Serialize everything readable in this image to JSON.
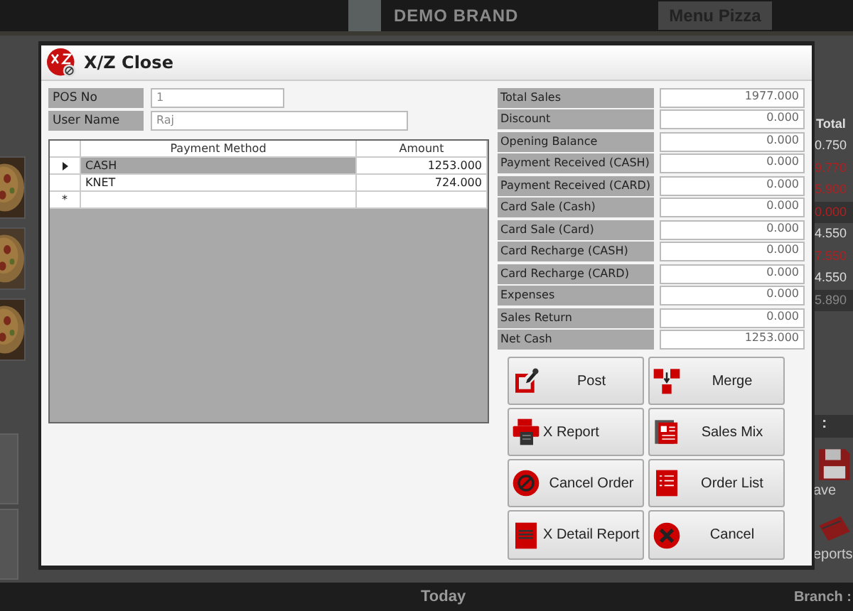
{
  "background": {
    "brand": "DEMO BRAND",
    "menu_button": "Menu Pizza",
    "totals_header": "Total",
    "totals": [
      {
        "value": "0.750",
        "color": "#dddddd",
        "shaded": false
      },
      {
        "value": "9.770",
        "color": "#b02020",
        "shaded": false
      },
      {
        "value": "5.900",
        "color": "#b02020",
        "shaded": false
      },
      {
        "value": "0.000",
        "color": "#b02020",
        "shaded": true
      },
      {
        "value": "4.550",
        "color": "#dddddd",
        "shaded": false
      },
      {
        "value": "7.550",
        "color": "#b02020",
        "shaded": false
      },
      {
        "value": "4.550",
        "color": "#dddddd",
        "shaded": false
      },
      {
        "value": "5.890",
        "color": "#888888",
        "shaded": true
      }
    ],
    "separator": ":",
    "side_buttons": [
      {
        "label": "ave",
        "kind": "save"
      },
      {
        "label": "eports",
        "kind": "reports"
      }
    ],
    "footer": {
      "date_label": "Today",
      "branch_label": "Branch :"
    }
  },
  "dialog": {
    "title": "X/Z Close",
    "fields": [
      {
        "label": "POS No",
        "value": "1"
      },
      {
        "label": "User Name",
        "value": "Raj"
      }
    ],
    "payments": {
      "columns": [
        "Payment Method",
        "Amount"
      ],
      "new_row_marker": "*",
      "rows": [
        {
          "method": "CASH",
          "amount": "1253.000",
          "selected": true
        },
        {
          "method": "KNET",
          "amount": "724.000",
          "selected": false
        }
      ]
    },
    "summary": [
      {
        "label": "Total Sales",
        "value": "1977.000"
      },
      {
        "label": "Discount",
        "value": "0.000"
      },
      {
        "label": "Opening Balance",
        "value": "0.000"
      },
      {
        "label": "Payment Received (CASH)",
        "value": "0.000"
      },
      {
        "label": "Payment Received (CARD)",
        "value": "0.000"
      },
      {
        "label": "Card Sale (Cash)",
        "value": "0.000"
      },
      {
        "label": "Card Sale (Card)",
        "value": "0.000"
      },
      {
        "label": "Card Recharge (CASH)",
        "value": "0.000"
      },
      {
        "label": "Card Recharge (CARD)",
        "value": "0.000"
      },
      {
        "label": "Expenses",
        "value": "0.000"
      },
      {
        "label": "Sales Return",
        "value": "0.000"
      },
      {
        "label": "Net Cash",
        "value": "1253.000"
      }
    ],
    "buttons": [
      {
        "label": "Post",
        "kind": "post"
      },
      {
        "label": "Merge",
        "kind": "merge"
      },
      {
        "label": "X Report",
        "kind": "printer"
      },
      {
        "label": "Sales Mix",
        "kind": "sales-mix"
      },
      {
        "label": "Cancel Order",
        "kind": "cancel-order"
      },
      {
        "label": "Order List",
        "kind": "list"
      },
      {
        "label": "X Detail Report",
        "kind": "detail"
      },
      {
        "label": "Cancel",
        "kind": "cancel"
      }
    ]
  }
}
